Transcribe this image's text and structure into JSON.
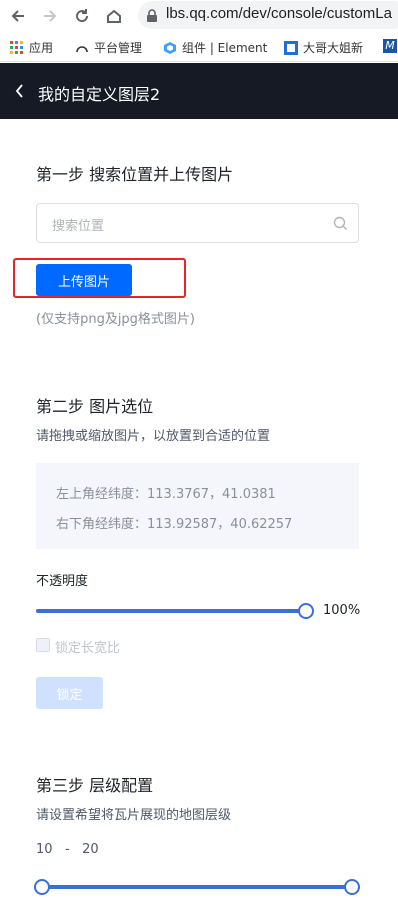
{
  "browser": {
    "url": "lbs.qq.com/dev/console/customLa",
    "bookmarks": [
      {
        "label": "应用",
        "icon": "apps-grid-icon"
      },
      {
        "label": "平台管理",
        "icon": "arc-icon"
      },
      {
        "label": "组件 | Element",
        "icon": "element-logo-icon"
      },
      {
        "label": "大哥大姐新",
        "icon": "bookmark-logo-icon"
      },
      {
        "label": "M",
        "icon": "m-logo-icon"
      }
    ]
  },
  "header": {
    "title": "我的自定义图层2"
  },
  "step1": {
    "title": "第一步 搜索位置并上传图片",
    "search_placeholder": "搜索位置",
    "upload_label": "上传图片",
    "hint": "(仅支持png及jpg格式图片)"
  },
  "step2": {
    "title": "第二步 图片选位",
    "desc": "请拖拽或缩放图片，以放置到合适的位置",
    "top_left": "左上角经纬度：113.3767，41.0381",
    "bottom_right": "右下角经纬度：113.92587，40.62257",
    "opacity_label": "不透明度",
    "opacity_value": "100%",
    "opacity_percent": 100,
    "lock_ratio_label": "锁定长宽比",
    "confirm_label": "锁定"
  },
  "step3": {
    "title": "第三步 层级配置",
    "desc": "请设置希望将瓦片展现的地图层级",
    "min_level": "10",
    "separator": "-",
    "max_level": "20"
  },
  "colors": {
    "accent": "#0069ff",
    "slider": "#3b6fd8",
    "header_bg": "#151a25",
    "highlight": "#e5242b"
  }
}
